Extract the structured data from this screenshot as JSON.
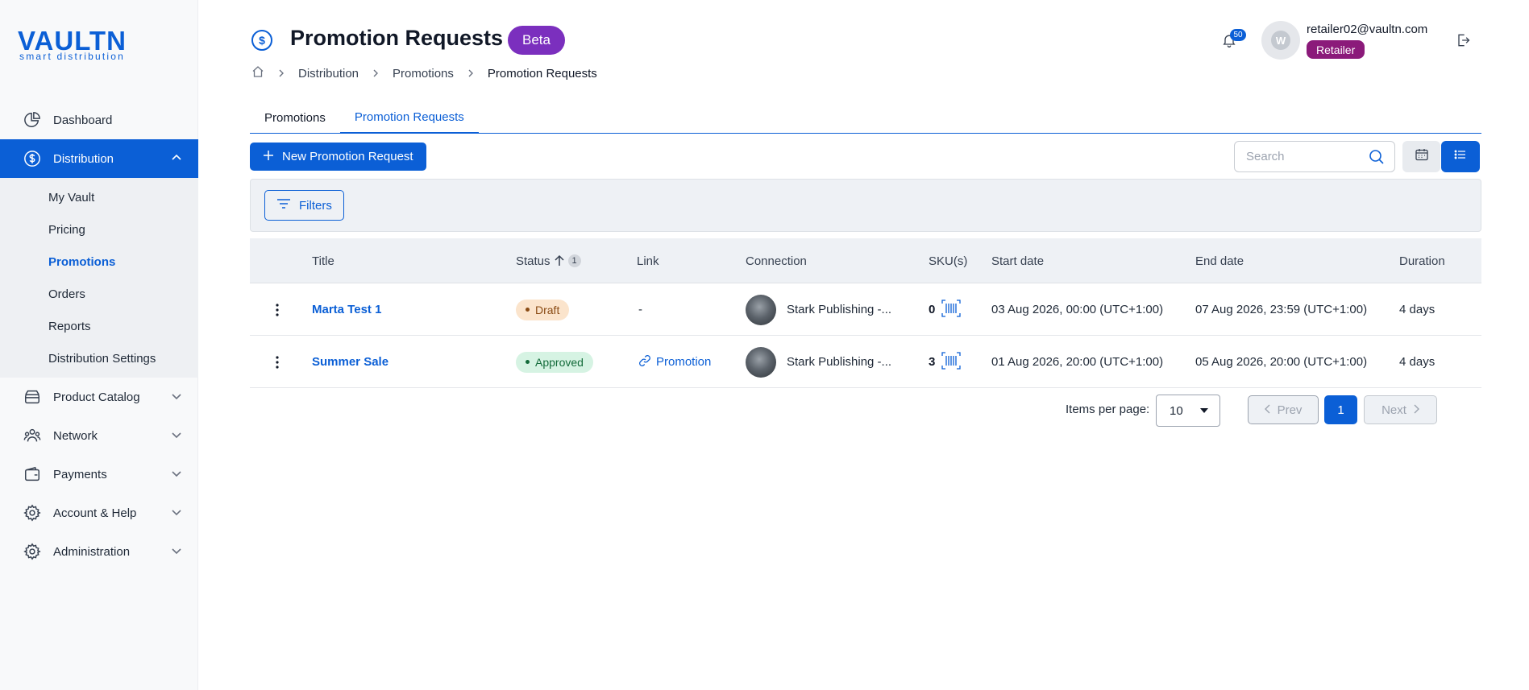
{
  "brand": {
    "name": "VAULTN",
    "tagline": "smart distribution"
  },
  "sidebar": {
    "items": [
      {
        "label": "Dashboard",
        "icon": "dashboard-icon"
      },
      {
        "label": "Distribution",
        "icon": "dollar-circle-icon",
        "expanded": true,
        "sub": [
          "My Vault",
          "Pricing",
          "Promotions",
          "Orders",
          "Reports",
          "Distribution Settings"
        ],
        "current": "Promotions"
      },
      {
        "label": "Product Catalog",
        "icon": "catalog-icon"
      },
      {
        "label": "Network",
        "icon": "network-icon"
      },
      {
        "label": "Payments",
        "icon": "wallet-icon"
      },
      {
        "label": "Account & Help",
        "icon": "gear-icon"
      },
      {
        "label": "Administration",
        "icon": "admin-gear-icon"
      }
    ]
  },
  "header": {
    "title": "Promotion Requests",
    "badge": "Beta",
    "breadcrumb": [
      "Distribution",
      "Promotions",
      "Promotion Requests"
    ],
    "notifications": "50",
    "user_email": "retailer02@vaultn.com",
    "role": "Retailer"
  },
  "tabs": [
    {
      "label": "Promotions",
      "active": false
    },
    {
      "label": "Promotion Requests",
      "active": true
    }
  ],
  "toolbar": {
    "new_label": "New Promotion Request",
    "search_placeholder": "Search",
    "filters_label": "Filters"
  },
  "table": {
    "columns": [
      "Title",
      "Status",
      "Link",
      "Connection",
      "SKU(s)",
      "Start date",
      "End date",
      "Duration"
    ],
    "sort_count": "1",
    "rows": [
      {
        "title": "Marta Test 1",
        "status": "Draft",
        "link": "-",
        "connection": "Stark Publishing -...",
        "skus": "0",
        "start": "03 Aug 2026, 00:00 (UTC+1:00)",
        "end": "07 Aug 2026, 23:59 (UTC+1:00)",
        "duration": "4 days"
      },
      {
        "title": "Summer Sale",
        "status": "Approved",
        "link": "Promotion",
        "connection": "Stark Publishing -...",
        "skus": "3",
        "start": "01 Aug 2026, 20:00 (UTC+1:00)",
        "end": "05 Aug 2026, 20:00 (UTC+1:00)",
        "duration": "4 days"
      }
    ]
  },
  "pagination": {
    "items_per_page_label": "Items per page:",
    "items_per_page": "10",
    "prev": "Prev",
    "page": "1",
    "next": "Next"
  },
  "colors": {
    "accent": "#0b5fd6",
    "beta": "#7b2fbe",
    "role": "#8b1a7a"
  }
}
